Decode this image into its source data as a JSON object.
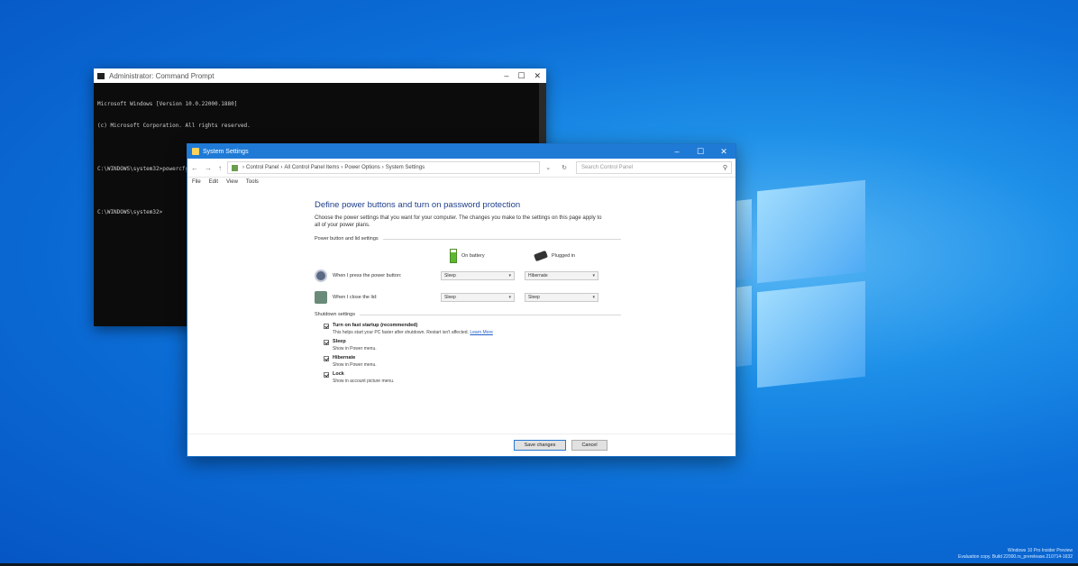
{
  "cmd": {
    "title": "Administrator: Command Prompt",
    "lines": [
      "Microsoft Windows [Version 10.0.22000.1880]",
      "(c) Microsoft Corporation. All rights reserved.",
      "",
      "C:\\WINDOWS\\system32>powercfg /h on",
      "",
      "C:\\WINDOWS\\system32>"
    ]
  },
  "window": {
    "title": "System Settings",
    "controls": {
      "minimize": "–",
      "maximize": "☐",
      "close": "✕"
    },
    "nav": {
      "back": "←",
      "forward": "→",
      "up": "↑"
    },
    "breadcrumb": [
      "Control Panel",
      "All Control Panel Items",
      "Power Options",
      "System Settings"
    ],
    "search_placeholder": "Search Control Panel",
    "menu": [
      "File",
      "Edit",
      "View",
      "Tools"
    ]
  },
  "content": {
    "heading": "Define power buttons and turn on password protection",
    "description": "Choose the power settings that you want for your computer. The changes you make to the settings on this page apply to all of your power plans.",
    "power_section_label": "Power button and lid settings",
    "columns": {
      "battery": "On battery",
      "plugged": "Plugged in"
    },
    "rows": [
      {
        "label": "When I press the power button:",
        "battery": "Sleep",
        "plugged": "Hibernate"
      },
      {
        "label": "When I close the lid:",
        "battery": "Sleep",
        "plugged": "Sleep"
      }
    ],
    "shutdown_section_label": "Shutdown settings",
    "options": [
      {
        "label": "Turn on fast startup (recommended)",
        "desc": "This helps start your PC faster after shutdown. Restart isn't affected.",
        "link": "Learn More",
        "checked": true
      },
      {
        "label": "Sleep",
        "desc": "Show in Power menu.",
        "link": "",
        "checked": true
      },
      {
        "label": "Hibernate",
        "desc": "Show in Power menu.",
        "link": "",
        "checked": true
      },
      {
        "label": "Lock",
        "desc": "Show in account picture menu.",
        "link": "",
        "checked": true
      }
    ],
    "save_label": "Save changes",
    "cancel_label": "Cancel"
  },
  "watermark": {
    "line1": "Windows 10 Pro Insider Preview",
    "line2": "Evaluation copy. Build 22000.rs_prerelease.210714-1632"
  },
  "colors": {
    "accent": "#1f7ad6",
    "link": "#1f5fc9",
    "heading": "#1e3f8a"
  }
}
